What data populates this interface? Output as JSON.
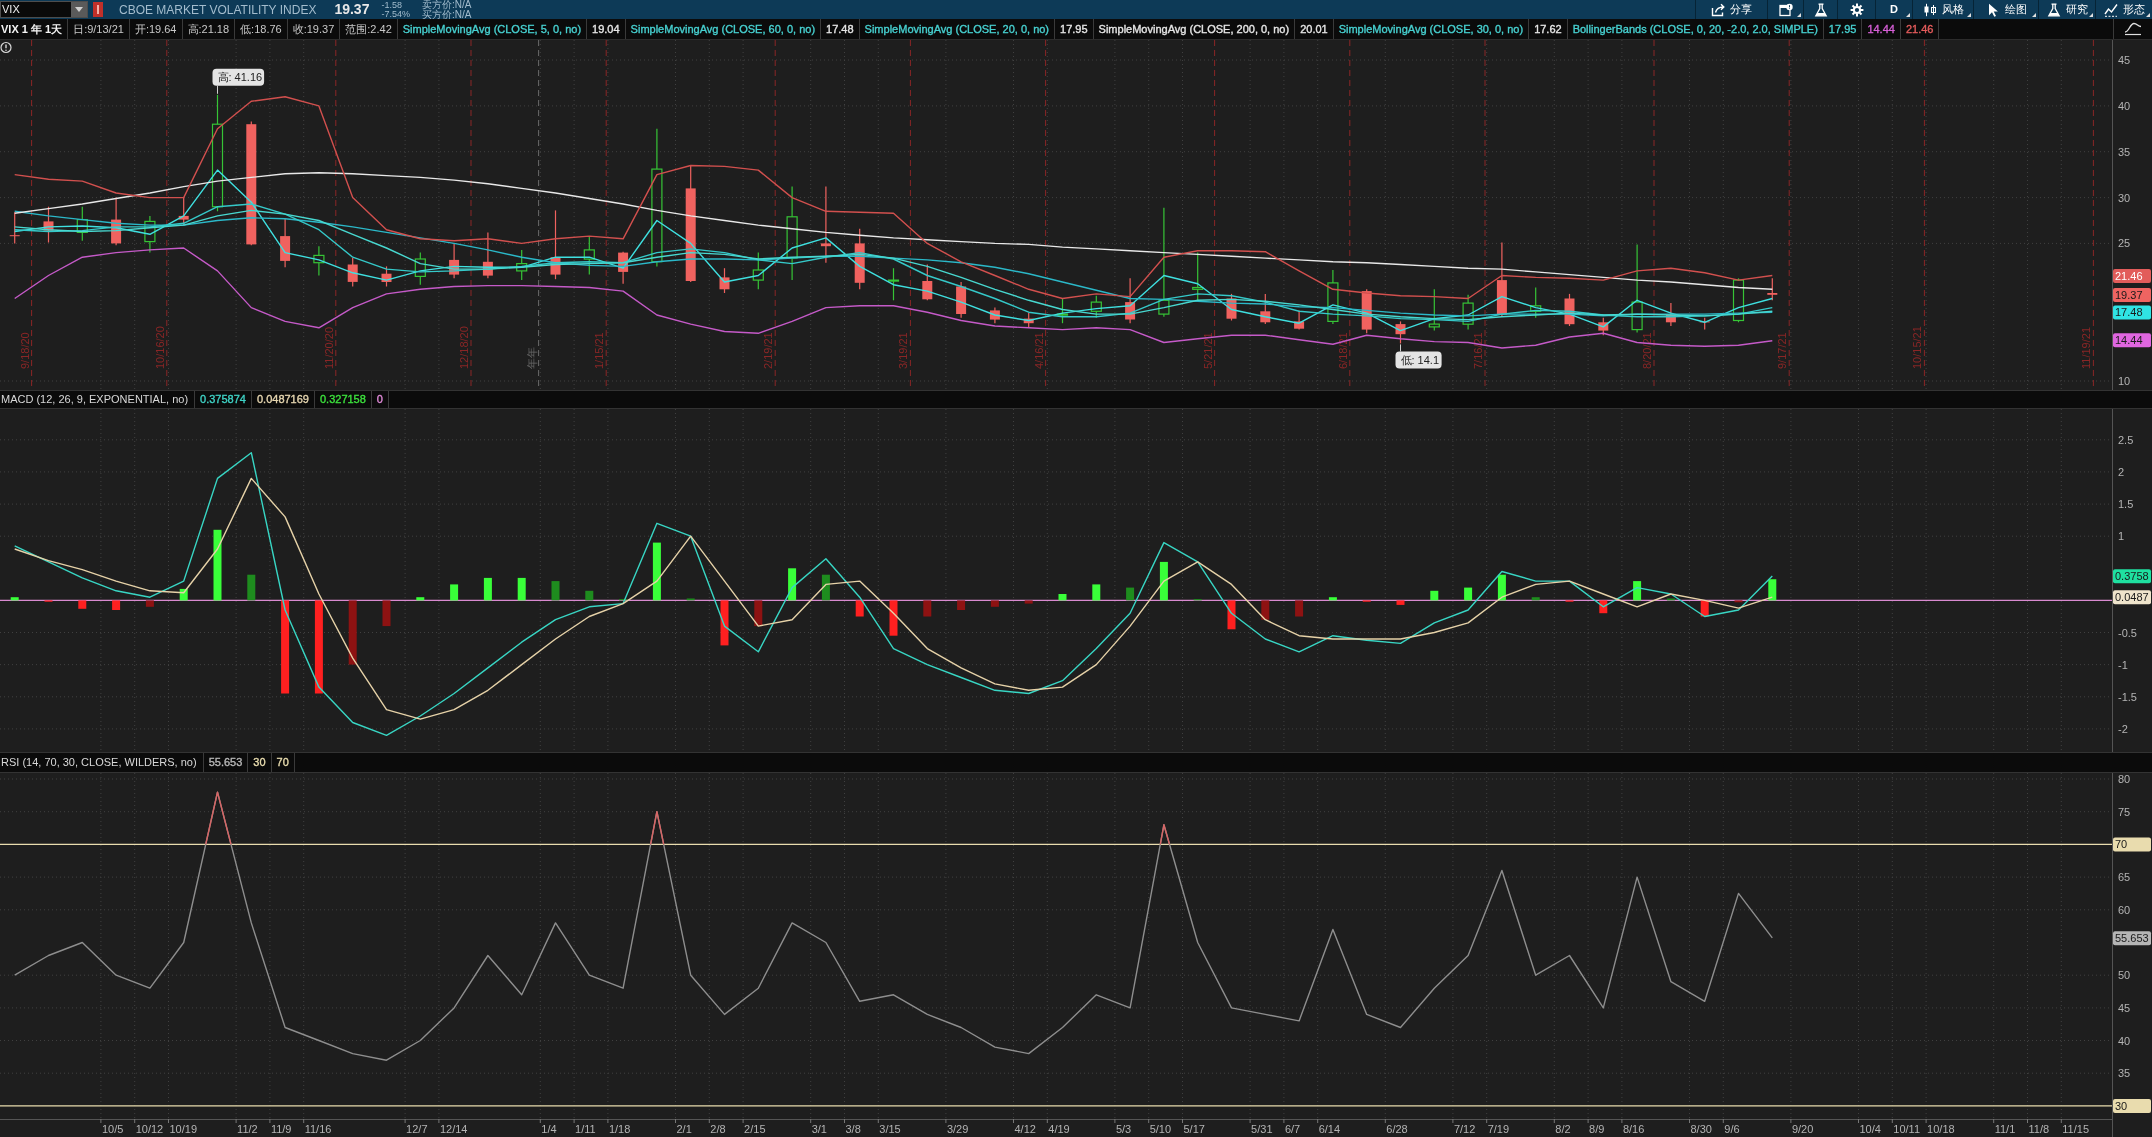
{
  "toolbar": {
    "symbol": "VIX",
    "description": "CBOE MARKET VOLATILITY INDEX",
    "last": "19.37",
    "change": "-1.58",
    "change_percent": "-7.54%",
    "ask": "卖方价:N/A",
    "bid": "买方价:N/A",
    "buttons": [
      {
        "kind": "share",
        "label": "分享",
        "menu": false
      },
      {
        "kind": "window",
        "menu": true
      },
      {
        "kind": "flask",
        "menu": false
      },
      {
        "kind": "gear",
        "menu": false
      },
      {
        "kind": "period",
        "label": "D",
        "menu": true
      },
      {
        "kind": "style",
        "label": "风格",
        "menu": true
      },
      {
        "kind": "drawing",
        "label": "绘图",
        "menu": true
      },
      {
        "kind": "studies",
        "label": "研究",
        "menu": true
      },
      {
        "kind": "patterns",
        "label": "形态",
        "menu": true
      }
    ]
  },
  "study_bar": {
    "title": "VIX 1 年 1天",
    "fields": [
      "日:9/13/21",
      "开:19.64",
      "高:21.18",
      "低:18.76",
      "收:19.37",
      "范围:2.42"
    ],
    "studies": [
      {
        "label": "SimpleMovingAvg (CLOSE, 5, 0, no)",
        "color": "#47d1d1",
        "values": [
          {
            "text": "19.04",
            "color": "#e6e6e6"
          }
        ]
      },
      {
        "label": "SimpleMovingAvg (CLOSE, 60, 0, no)",
        "color": "#47d1d1",
        "values": [
          {
            "text": "17.48",
            "color": "#e6e6e6"
          }
        ]
      },
      {
        "label": "SimpleMovingAvg (CLOSE, 20, 0, no)",
        "color": "#47d1d1",
        "values": [
          {
            "text": "17.95",
            "color": "#e6e6e6"
          }
        ]
      },
      {
        "label": "SimpleMovingAvg (CLOSE, 200, 0, no)",
        "color": "#e6e6e6",
        "values": [
          {
            "text": "20.01",
            "color": "#e6e6e6"
          }
        ]
      },
      {
        "label": "SimpleMovingAvg (CLOSE, 30, 0, no)",
        "color": "#47d1d1",
        "values": [
          {
            "text": "17.62",
            "color": "#e6e6e6"
          }
        ]
      },
      {
        "label": "BollingerBands (CLOSE, 0, 20, -2.0, 2.0, SIMPLE)",
        "color": "#47d1d1",
        "values": [
          {
            "text": "17.95",
            "color": "#47d1d1"
          },
          {
            "text": "14.44",
            "color": "#d75fd7"
          },
          {
            "text": "21.46",
            "color": "#e65c5c"
          }
        ]
      }
    ]
  },
  "price_pane": {
    "chart_data": {
      "type": "candlestick",
      "grid": true,
      "ylim": [
        9.02,
        47.18
      ],
      "yticks": [
        10,
        25,
        30,
        35,
        40,
        45
      ],
      "categories": [
        "9/18/20",
        null,
        null,
        null,
        "10/16/20",
        null,
        null,
        null,
        null,
        "11/20/20",
        null,
        null,
        null,
        "12/18/20",
        null,
        "年年",
        null,
        "1/15/21",
        null,
        null,
        null,
        null,
        "2/19/21",
        null,
        null,
        null,
        "3/19/21",
        null,
        null,
        null,
        "4/16/21",
        null,
        null,
        null,
        null,
        "5/21/21",
        null,
        null,
        null,
        "6/18/21",
        null,
        null,
        null,
        "7/16/21",
        null,
        null,
        null,
        null,
        "8/20/21",
        null,
        null,
        null,
        "9/17/21",
        null,
        null,
        null,
        "10/15/21",
        null,
        null,
        null,
        null,
        "11/19/21"
      ],
      "ohlc": [
        [
          25.9,
          28.4,
          25.0,
          25.8
        ],
        [
          27.4,
          29.0,
          25.1,
          26.4
        ],
        [
          26.2,
          29.0,
          25.3,
          27.6
        ],
        [
          27.6,
          30.0,
          24.8,
          25.0
        ],
        [
          25.2,
          28.0,
          24.0,
          27.4
        ],
        [
          28.0,
          30.0,
          27.0,
          27.6
        ],
        [
          29.0,
          41.2,
          28.5,
          38.0
        ],
        [
          38.0,
          38.3,
          24.8,
          24.9
        ],
        [
          25.8,
          27.7,
          22.4,
          23.1
        ],
        [
          22.9,
          24.7,
          21.5,
          23.7
        ],
        [
          22.7,
          23.4,
          20.3,
          20.8
        ],
        [
          21.7,
          22.5,
          20.3,
          20.8
        ],
        [
          21.4,
          24.0,
          20.5,
          23.3
        ],
        [
          23.2,
          25.0,
          21.2,
          21.6
        ],
        [
          23.0,
          26.2,
          21.2,
          21.5
        ],
        [
          22.0,
          24.3,
          21.0,
          22.8
        ],
        [
          23.5,
          28.6,
          21.1,
          21.6
        ],
        [
          23.3,
          25.8,
          21.6,
          24.3
        ],
        [
          24.0,
          24.1,
          20.6,
          21.9
        ],
        [
          23.0,
          37.5,
          22.5,
          33.1
        ],
        [
          31.0,
          33.5,
          20.8,
          20.9
        ],
        [
          21.3,
          22.3,
          19.6,
          20.0
        ],
        [
          21.0,
          24.0,
          20.0,
          22.1
        ],
        [
          23.4,
          31.2,
          21.0,
          27.9
        ],
        [
          25.0,
          31.2,
          22.9,
          24.7
        ],
        [
          25.0,
          26.6,
          20.0,
          20.7
        ],
        [
          21.0,
          22.3,
          18.8,
          21.0
        ],
        [
          20.9,
          22.7,
          18.8,
          18.9
        ],
        [
          20.3,
          20.8,
          16.9,
          17.3
        ],
        [
          17.7,
          18.0,
          16.3,
          16.7
        ],
        [
          16.8,
          17.4,
          15.9,
          16.3
        ],
        [
          17.3,
          19.0,
          16.3,
          17.3
        ],
        [
          17.6,
          19.3,
          16.9,
          18.6
        ],
        [
          18.6,
          21.2,
          16.3,
          16.7
        ],
        [
          17.3,
          28.9,
          17.0,
          18.8
        ],
        [
          20.0,
          24.0,
          18.8,
          20.2
        ],
        [
          19.0,
          19.5,
          16.6,
          16.8
        ],
        [
          17.6,
          19.5,
          16.2,
          16.4
        ],
        [
          16.5,
          17.7,
          15.6,
          15.7
        ],
        [
          16.5,
          22.1,
          16.2,
          20.7
        ],
        [
          19.8,
          20.0,
          15.2,
          15.6
        ],
        [
          16.2,
          16.5,
          14.1,
          15.1
        ],
        [
          15.9,
          20.0,
          15.5,
          16.2
        ],
        [
          16.2,
          19.4,
          15.6,
          18.5
        ],
        [
          21.0,
          25.1,
          17.0,
          17.2
        ],
        [
          17.6,
          20.2,
          16.9,
          18.2
        ],
        [
          19.0,
          19.5,
          16.0,
          16.2
        ],
        [
          16.4,
          16.9,
          15.0,
          15.5
        ],
        [
          15.6,
          24.9,
          15.3,
          18.6
        ],
        [
          17.2,
          18.5,
          16.0,
          16.4
        ],
        [
          16.5,
          16.9,
          15.6,
          16.4
        ],
        [
          16.6,
          21.2,
          16.4,
          21.0
        ],
        [
          19.6,
          21.2,
          18.8,
          19.4
        ],
        null,
        null,
        null,
        null,
        null,
        null,
        null,
        null,
        null
      ],
      "series": [
        {
          "type": "line",
          "color": "#3fe0e0",
          "values": [
            26.3,
            26.8,
            26.9,
            26.7,
            26.0,
            28.0,
            33.0,
            29.5,
            24.0,
            23.2,
            21.8,
            21.0,
            22.0,
            22.5,
            22.4,
            22.4,
            23.5,
            23.5,
            22.3,
            27.5,
            25.0,
            20.8,
            21.5,
            24.5,
            25.6,
            22.5,
            20.5,
            19.8,
            18.6,
            17.2,
            16.6,
            17.4,
            17.9,
            18.2,
            21.5,
            20.6,
            17.8,
            17.0,
            16.3,
            18.3,
            17.4,
            15.5,
            16.8,
            17.2,
            19.2,
            18.0,
            17.3,
            15.9,
            18.8,
            17.4,
            16.4,
            18.0,
            19.0,
            null,
            null,
            null,
            null,
            null,
            null,
            null,
            null,
            null
          ]
        },
        {
          "type": "line",
          "color": "#2bb8c8",
          "values": [
            28.5,
            28.0,
            27.6,
            27.2,
            27.0,
            27.0,
            27.5,
            27.8,
            27.7,
            27.3,
            26.8,
            26.2,
            25.6,
            25.0,
            24.3,
            23.5,
            22.9,
            22.6,
            22.5,
            23.0,
            23.3,
            23.3,
            23.2,
            23.4,
            23.6,
            23.6,
            23.4,
            23.2,
            22.9,
            22.4,
            21.7,
            20.8,
            19.9,
            19.0,
            18.9,
            18.7,
            18.5,
            18.4,
            18.1,
            18.0,
            17.7,
            17.4,
            17.2,
            17.1,
            17.3,
            17.3,
            17.3,
            17.1,
            17.3,
            17.3,
            17.3,
            17.4,
            17.5,
            null,
            null,
            null,
            null,
            null,
            null,
            null,
            null,
            null
          ]
        },
        {
          "type": "line",
          "color": "#35c9c9",
          "values": [
            26.5,
            26.3,
            26.4,
            26.8,
            26.8,
            27.2,
            29.0,
            29.3,
            28.2,
            26.5,
            23.5,
            22.2,
            21.9,
            22.0,
            22.2,
            22.5,
            22.9,
            23.0,
            22.9,
            24.0,
            24.4,
            24.0,
            23.2,
            22.8,
            23.5,
            24.0,
            23.3,
            21.5,
            20.3,
            19.0,
            17.5,
            17.0,
            17.0,
            17.4,
            18.9,
            19.5,
            19.3,
            18.6,
            17.6,
            17.3,
            17.1,
            16.8,
            16.7,
            16.5,
            17.3,
            17.7,
            17.6,
            17.2,
            17.0,
            17.0,
            17.1,
            17.3,
            18.0,
            null,
            null,
            null,
            null,
            null,
            null,
            null,
            null,
            null
          ]
        },
        {
          "type": "line",
          "color": "#e8e8e8",
          "values": [
            28.3,
            28.8,
            29.3,
            29.9,
            30.5,
            31.2,
            31.8,
            32.2,
            32.6,
            32.7,
            32.6,
            32.4,
            32.2,
            31.9,
            31.5,
            31.0,
            30.5,
            29.9,
            29.3,
            28.6,
            28.0,
            27.5,
            27.0,
            26.6,
            26.2,
            25.9,
            25.6,
            25.4,
            25.2,
            25.0,
            24.9,
            24.6,
            24.4,
            24.2,
            24.0,
            23.8,
            23.6,
            23.4,
            23.2,
            23.0,
            22.9,
            22.7,
            22.5,
            22.3,
            22.2,
            21.9,
            21.6,
            21.3,
            21.0,
            20.8,
            20.5,
            20.2,
            20.0,
            null,
            null,
            null,
            null,
            null,
            null,
            null,
            null,
            null
          ]
        },
        {
          "type": "line",
          "color": "#48d8d0",
          "values": [
            26.8,
            26.5,
            26.3,
            26.4,
            26.7,
            27.0,
            28.0,
            28.6,
            28.2,
            27.5,
            26.0,
            24.5,
            22.8,
            22.2,
            22.2,
            22.4,
            22.7,
            22.8,
            22.9,
            23.5,
            24.0,
            23.8,
            23.3,
            23.5,
            23.6,
            23.8,
            23.4,
            22.5,
            21.3,
            20.0,
            18.8,
            17.8,
            17.3,
            17.3,
            18.0,
            18.8,
            18.9,
            18.7,
            18.3,
            17.8,
            17.3,
            17.0,
            16.8,
            16.7,
            17.0,
            17.2,
            17.4,
            17.2,
            17.3,
            17.2,
            17.1,
            17.3,
            17.6,
            null,
            null,
            null,
            null,
            null,
            null,
            null,
            null,
            null
          ]
        },
        {
          "type": "line",
          "color": "#d2504e",
          "values": [
            32.5,
            32.0,
            31.8,
            30.5,
            30.0,
            30.0,
            37.5,
            40.5,
            41.0,
            40.0,
            30.0,
            26.5,
            25.5,
            25.3,
            25.5,
            25.0,
            25.5,
            25.8,
            25.5,
            32.5,
            33.5,
            33.4,
            33.0,
            30.0,
            28.5,
            28.4,
            28.3,
            25.0,
            23.0,
            21.5,
            20.0,
            19.0,
            19.5,
            19.2,
            23.5,
            24.2,
            24.2,
            24.1,
            22.0,
            20.0,
            19.6,
            19.3,
            19.2,
            19.0,
            21.5,
            21.3,
            21.2,
            21.0,
            22.0,
            22.3,
            21.8,
            21.0,
            21.5,
            null,
            null,
            null,
            null,
            null,
            null,
            null,
            null,
            null
          ]
        },
        {
          "type": "line",
          "color": "#c55ac8",
          "values": [
            19.0,
            21.5,
            23.5,
            24.0,
            24.3,
            24.5,
            22.0,
            18.0,
            16.5,
            15.8,
            18.0,
            19.5,
            20.0,
            20.3,
            20.4,
            20.4,
            20.3,
            20.2,
            19.8,
            17.2,
            16.2,
            15.4,
            15.2,
            16.5,
            18.0,
            18.2,
            18.2,
            17.5,
            16.6,
            16.0,
            15.8,
            15.6,
            15.8,
            15.6,
            14.2,
            14.6,
            15.0,
            15.0,
            14.5,
            14.0,
            15.0,
            14.6,
            14.3,
            14.2,
            13.6,
            13.9,
            14.8,
            15.2,
            14.2,
            13.9,
            13.8,
            13.9,
            14.4,
            null,
            null,
            null,
            null,
            null,
            null,
            null,
            null,
            null
          ]
        }
      ],
      "ref_lines": [
        {
          "axis": "x",
          "value": "年年",
          "color": "#6a6a6a"
        }
      ],
      "annotations": [
        "高: 41.16",
        "低: 14.1"
      ]
    },
    "axis_tags": [
      {
        "text": "21.46",
        "color": "#e25c5a"
      },
      {
        "text": "19.37",
        "color": "#ef6461"
      },
      {
        "text": "17.48",
        "color": "#2fe4e4"
      },
      {
        "text": "14.44",
        "color": "#e066e0"
      }
    ]
  },
  "macd_pane": {
    "header": {
      "title": "MACD (12, 26, 9, EXPONENTIAL, no)",
      "values": [
        {
          "text": "0.375874",
          "color": "#3fd3c6"
        },
        {
          "text": "0.0487169",
          "color": "#e6d6b0"
        },
        {
          "text": "0.327158",
          "color": "#3ce03c"
        },
        {
          "text": "0",
          "color": "#e08ad8"
        }
      ]
    },
    "chart_data": {
      "type": "line",
      "grid": true,
      "ylim": [
        -2.36,
        2.98
      ],
      "yticks": [
        -2,
        -1.5,
        -1,
        -0.5,
        1,
        1.5,
        2,
        2.5
      ],
      "categories": [
        null,
        null,
        null,
        null,
        null,
        null,
        null,
        null,
        null,
        null,
        null,
        null,
        null,
        null,
        null,
        null,
        null,
        null,
        null,
        null,
        null,
        null,
        null,
        null,
        null,
        null,
        null,
        null,
        null,
        null,
        null,
        null,
        null,
        null,
        null,
        null,
        null,
        null,
        null,
        null,
        null,
        null,
        null,
        null,
        null,
        null,
        null,
        null,
        null,
        null,
        null,
        null,
        null,
        null,
        null,
        null,
        null,
        null,
        null,
        null,
        null,
        null
      ],
      "series": [
        {
          "type": "line",
          "color": "#38d6c4",
          "values": [
            0.85,
            0.6,
            0.35,
            0.15,
            0.05,
            0.3,
            1.9,
            2.3,
            -0.15,
            -1.35,
            -1.9,
            -2.1,
            -1.8,
            -1.45,
            -1.05,
            -0.65,
            -0.3,
            -0.1,
            -0.05,
            1.2,
            1.0,
            -0.4,
            -0.8,
            0.2,
            0.65,
            0.05,
            -0.75,
            -1.0,
            -1.2,
            -1.4,
            -1.45,
            -1.25,
            -0.75,
            -0.2,
            0.9,
            0.6,
            -0.2,
            -0.6,
            -0.8,
            -0.55,
            -0.62,
            -0.67,
            -0.35,
            -0.15,
            0.45,
            0.3,
            0.3,
            -0.1,
            0.2,
            0.1,
            -0.25,
            -0.15,
            0.38,
            null,
            null,
            null,
            null,
            null,
            null,
            null,
            null,
            null
          ]
        },
        {
          "type": "line",
          "color": "#e6d2a8",
          "values": [
            0.8,
            0.62,
            0.48,
            0.3,
            0.15,
            0.12,
            0.8,
            1.9,
            1.3,
            0.1,
            -0.9,
            -1.7,
            -1.85,
            -1.7,
            -1.4,
            -1.0,
            -0.6,
            -0.25,
            -0.05,
            0.3,
            1.0,
            0.3,
            -0.4,
            -0.3,
            0.25,
            0.3,
            -0.2,
            -0.75,
            -1.05,
            -1.3,
            -1.4,
            -1.35,
            -1.0,
            -0.4,
            0.3,
            0.6,
            0.25,
            -0.3,
            -0.55,
            -0.6,
            -0.6,
            -0.6,
            -0.5,
            -0.35,
            0.05,
            0.25,
            0.3,
            0.1,
            -0.1,
            0.1,
            0.0,
            -0.12,
            0.05,
            null,
            null,
            null,
            null,
            null,
            null,
            null,
            null,
            null
          ]
        },
        {
          "type": "bar",
          "values": [
            0.05,
            -0.02,
            -0.13,
            -0.15,
            -0.1,
            0.18,
            1.1,
            0.4,
            -1.45,
            -1.45,
            -1.0,
            -0.4,
            0.05,
            0.25,
            0.35,
            0.35,
            0.3,
            0.15,
            0.02,
            0.9,
            0.03,
            -0.7,
            -0.4,
            0.5,
            0.4,
            -0.25,
            -0.55,
            -0.25,
            -0.15,
            -0.1,
            -0.05,
            0.1,
            0.25,
            0.2,
            0.6,
            0.02,
            -0.45,
            -0.3,
            -0.25,
            0.05,
            -0.02,
            -0.07,
            0.15,
            0.2,
            0.4,
            0.05,
            -0.02,
            -0.2,
            0.3,
            0.03,
            -0.25,
            -0.03,
            0.33,
            null,
            null,
            null,
            null,
            null,
            null,
            null,
            null,
            null
          ],
          "colors": [
            "#39ff39",
            "#ff2020",
            "#ff2020",
            "#ff2020",
            "#8e1212",
            "#39ff39",
            "#39ff39",
            "#1e8c1e",
            "#ff2020",
            "#ff2020",
            "#8e1212",
            "#8e1212",
            "#39ff39",
            "#39ff39",
            "#39ff39",
            "#39ff39",
            "#1e8c1e",
            "#1e8c1e",
            "#1e8c1e",
            "#39ff39",
            "#1e8c1e",
            "#ff2020",
            "#8e1212",
            "#39ff39",
            "#1e8c1e",
            "#ff2020",
            "#ff2020",
            "#8e1212",
            "#8e1212",
            "#8e1212",
            "#8e1212",
            "#39ff39",
            "#39ff39",
            "#1e8c1e",
            "#39ff39",
            "#1e8c1e",
            "#ff2020",
            "#8e1212",
            "#8e1212",
            "#39ff39",
            "#ff2020",
            "#ff2020",
            "#39ff39",
            "#39ff39",
            "#39ff39",
            "#1e8c1e",
            "#ff2020",
            "#ff2020",
            "#39ff39",
            "#1e8c1e",
            "#ff2020",
            "#8e1212",
            "#39ff39",
            null,
            null,
            null,
            null,
            null,
            null,
            null,
            null,
            null
          ]
        }
      ],
      "ref_lines": [
        {
          "axis": "y",
          "value": 0,
          "color": "#d98ad0"
        }
      ]
    },
    "axis_tags": [
      {
        "text": "0.3758",
        "color": "#1fe0a0"
      },
      {
        "text": "0.0487",
        "color": "#efe4cc"
      }
    ]
  },
  "rsi_pane": {
    "header": {
      "title": "RSI (14, 70, 30, CLOSE, WILDERS, no)",
      "values": [
        {
          "text": "55.653",
          "color": "#b8b8b8"
        },
        {
          "text": "30",
          "color": "#e8dcae"
        },
        {
          "text": "70",
          "color": "#e8dcae"
        }
      ]
    },
    "chart_data": {
      "type": "line",
      "grid": true,
      "ylim": [
        28.0,
        80.92
      ],
      "yticks": [
        35,
        40,
        45,
        50,
        60,
        65,
        75,
        80
      ],
      "categories": [
        null,
        null,
        null,
        "10/5",
        "10/12",
        "10/19",
        null,
        "11/2",
        "11/9",
        "11/16",
        null,
        null,
        "12/7",
        "12/14",
        null,
        null,
        "1/4",
        "1/11",
        "1/18",
        null,
        "2/1",
        "2/8",
        "2/15",
        null,
        "3/1",
        "3/8",
        "3/15",
        null,
        "3/29",
        null,
        "4/12",
        "4/19",
        null,
        "5/3",
        "5/10",
        "5/17",
        null,
        "5/31",
        "6/7",
        "6/14",
        null,
        "6/28",
        null,
        "7/12",
        "7/19",
        null,
        "8/2",
        "8/9",
        "8/16",
        null,
        "8/30",
        "9/6",
        null,
        "9/20",
        null,
        "10/4",
        "10/11",
        "10/18",
        null,
        "11/1",
        "11/8",
        "11/15"
      ],
      "series": [
        {
          "type": "line",
          "color": "#8e8e8e",
          "values": [
            50,
            53,
            55,
            50,
            48,
            55,
            78,
            58,
            42,
            40,
            38,
            37,
            40,
            45,
            53,
            47,
            58,
            50,
            48,
            75,
            50,
            44,
            48,
            58,
            55,
            46,
            47,
            44,
            42,
            39,
            38,
            42,
            47,
            45,
            73,
            55,
            45,
            44,
            43,
            57,
            44,
            42,
            48,
            53,
            66,
            50,
            53,
            45,
            65,
            49,
            46,
            62.5,
            55.7,
            null,
            null,
            null,
            null,
            null,
            null,
            null,
            null,
            null
          ]
        }
      ],
      "ref_lines": [
        {
          "axis": "y",
          "value": 70,
          "label": "70",
          "color": "#e9dcae"
        },
        {
          "axis": "y",
          "value": 30,
          "label": "30",
          "color": "#e9dcae"
        }
      ]
    },
    "axis_tags": [
      {
        "text": "55.653",
        "color": "#b5b5b5"
      }
    ]
  }
}
